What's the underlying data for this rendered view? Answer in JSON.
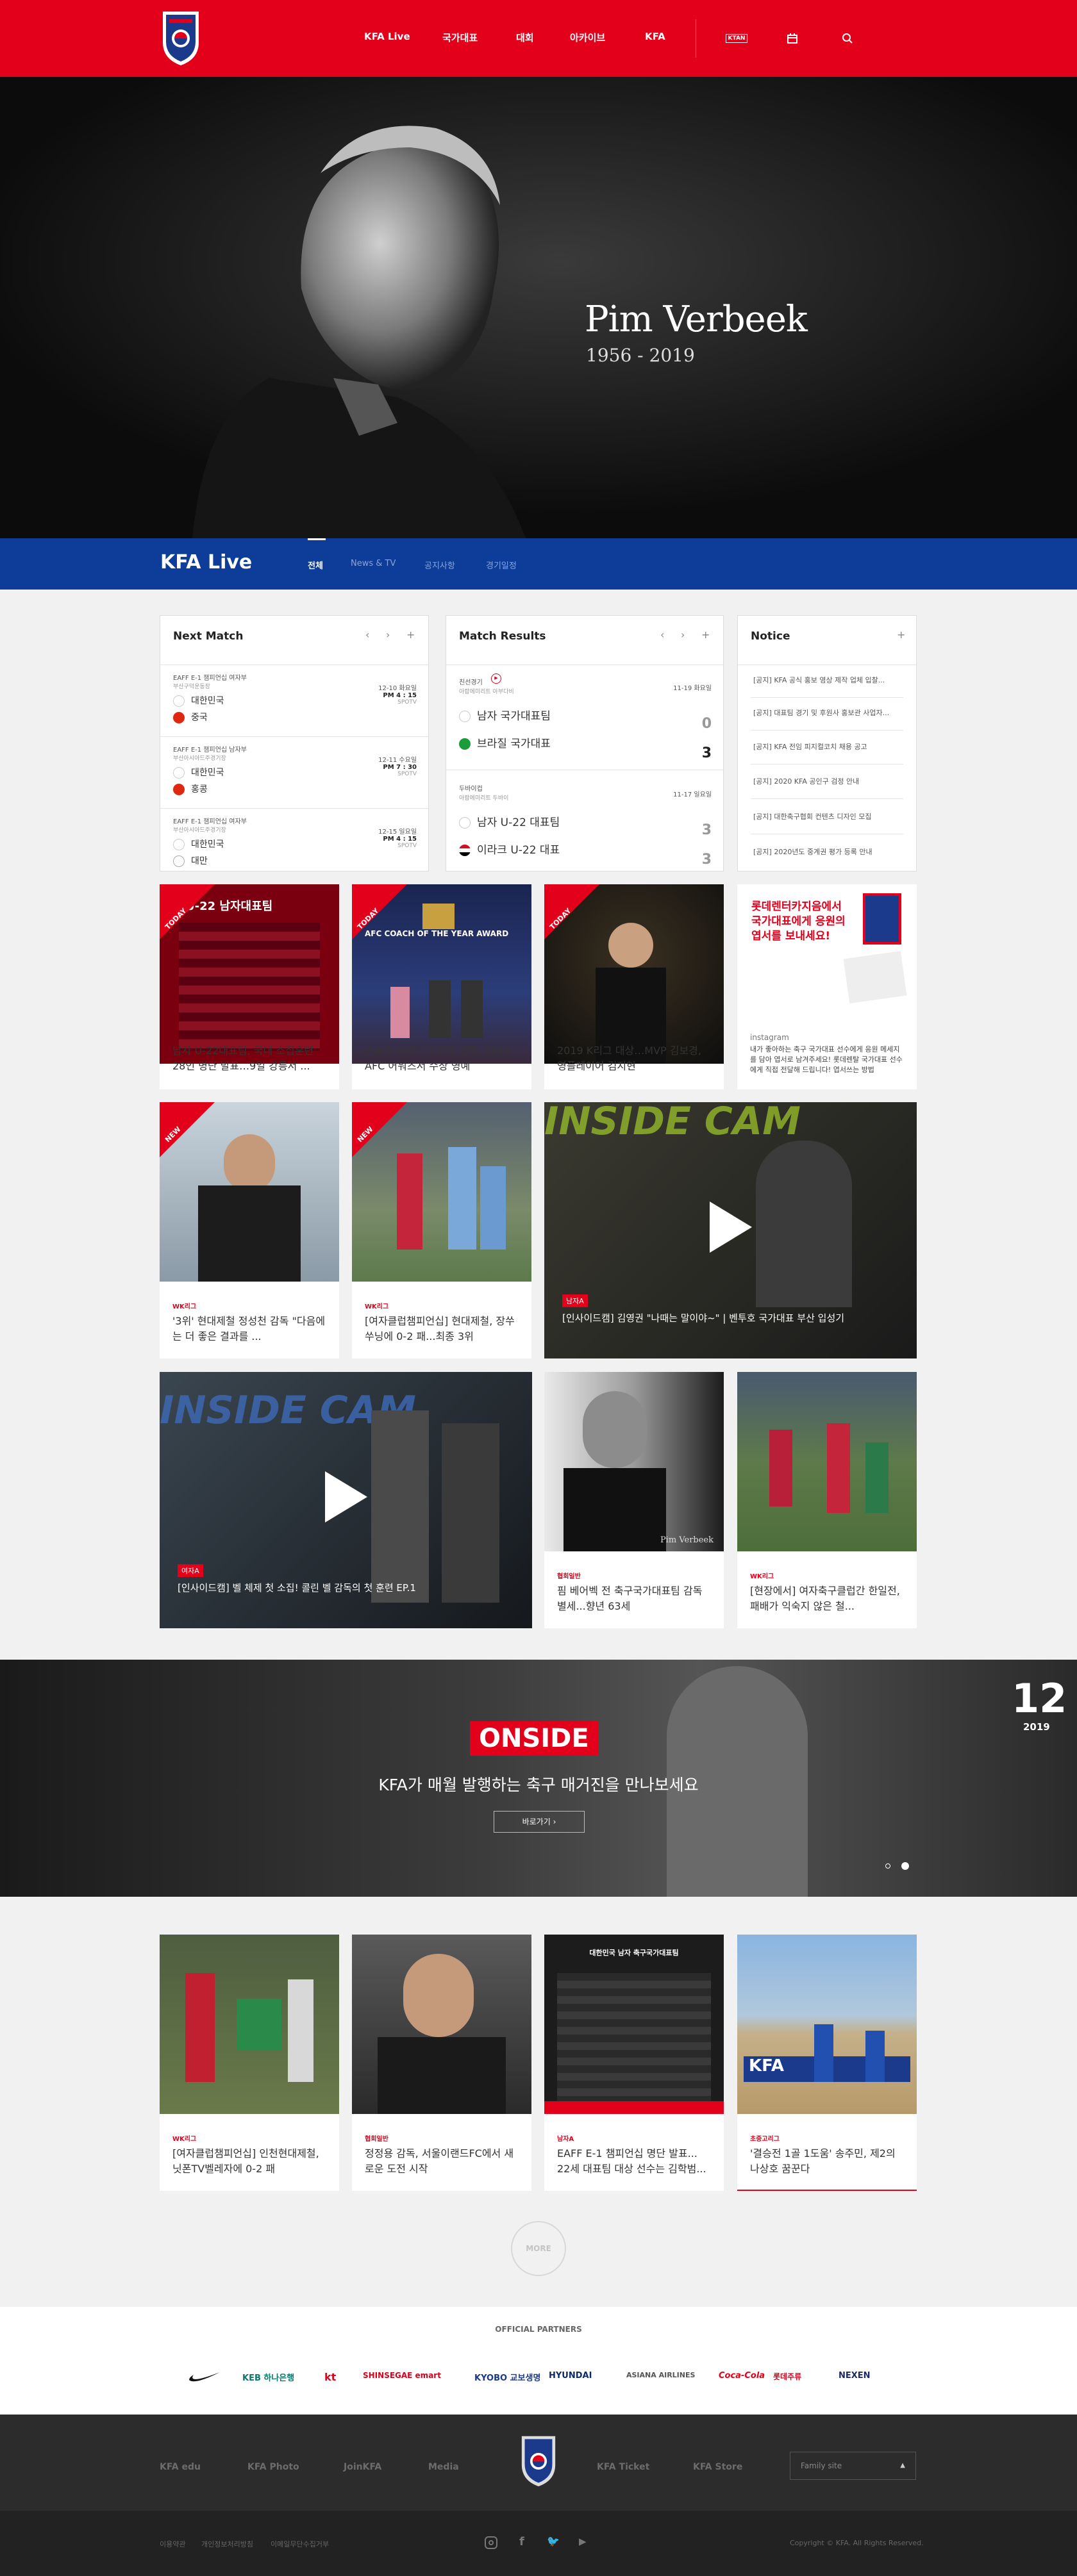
{
  "header": {
    "nav": [
      "KFA Live",
      "국가대표",
      "대회",
      "아카이브",
      "KFA"
    ],
    "ktan_label": "KTAN"
  },
  "hero": {
    "name": "Pim Verbeek",
    "years": "1956 - 2019"
  },
  "live_bar": {
    "title": "KFA Live",
    "tabs": [
      "전체",
      "News & TV",
      "공지사항",
      "경기일정"
    ]
  },
  "next_match": {
    "title": "Next Match",
    "items": [
      {
        "comp": "EAFF E-1 챔피언십 여자부",
        "venue": "부산구덕운동장",
        "home": "대한민국",
        "away": "중국",
        "date": "12-10 화요일",
        "time": "PM 4 : 15",
        "tv": "SPOTV"
      },
      {
        "comp": "EAFF E-1 챔피언십 남자부",
        "venue": "부산아시아드주경기장",
        "home": "대한민국",
        "away": "홍콩",
        "date": "12-11 수요일",
        "time": "PM 7 : 30",
        "tv": "SPOTV"
      },
      {
        "comp": "EAFF E-1 챔피언십 여자부",
        "venue": "부산아시아드주경기장",
        "home": "대한민국",
        "away": "대만",
        "date": "12-15 일요일",
        "time": "PM 4 : 15",
        "tv": "SPOTV"
      }
    ]
  },
  "match_results": {
    "title": "Match Results",
    "items": [
      {
        "type": "친선경기",
        "venue": "아랍에미리트 아부다비",
        "date": "11-19 화요일",
        "home": "남자 국가대표팀",
        "home_score": "0",
        "away": "브라질 국가대표",
        "away_score": "3"
      },
      {
        "type": "두바이컵",
        "venue": "아랍에미리트 두바이",
        "date": "11-17 일요일",
        "home": "남자 U-22 대표팀",
        "home_score": "3",
        "away": "이라크 U-22 대표",
        "away_score": "3"
      }
    ]
  },
  "notice": {
    "title": "Notice",
    "items": [
      "[공지] KFA 공식 홍보 영상 제작 업체 입찰...",
      "[공지] 대표팀 경기 및 후원사 홍보관 사업자...",
      "[공지] KFA 전임 피지컬코치 채용 공고",
      "[공지] 2020 KFA 공인구 검정 안내",
      "[공지] 대한축구협회 컨텐츠 디자인 모집",
      "[공지] 2020년도 중계권 평가 등록 안내"
    ]
  },
  "cards_row1": [
    {
      "ribbon": "TODAY",
      "cat": "",
      "title": "남자 U-22대표팀, 국내 소집훈련 28인 명단 발표…9일 강릉서 ...",
      "img_text": "U-22 남자대표팀"
    },
    {
      "ribbon": "TODAY",
      "cat": "",
      "title": "손흥민·이강인·정정용 감독, 2019 AFC 어워즈서 수상 영예",
      "img_text": "AFC COACH OF THE YEAR AWARD"
    },
    {
      "ribbon": "TODAY",
      "cat": "",
      "title": "2019 K리그 대상…MVP 김보경, 영플레이어 김지현",
      "img_text": ""
    },
    {
      "ribbon": "",
      "cat": "",
      "title": "내가 좋아하는 축구 국가대표 선수에게 응원 메세지를 담아 엽서로 남겨주세요! 롯데렌탈 국가대표 선수에게 직접 전달해 드립니다! 엽서쓰는 방법",
      "img_text": "롯데렌터카지음에서 국가대표에게 응원의 엽서를 보내세요!",
      "extra": "instagram"
    }
  ],
  "cards_row2": [
    {
      "ribbon": "NEW",
      "cat": "WK리그",
      "title": "'3위' 현대제철 정성천 감독 \"다음에는 더 좋은 결과를 ..."
    },
    {
      "ribbon": "NEW",
      "cat": "WK리그",
      "title": "[여자클럽챔피언십] 현대제철, 장쑤쑤닝에 0-2 패...최종 3위"
    },
    {
      "video": true,
      "tag": "남자A",
      "caption": "[인사이드캠] 김영권 \"나때는 말이야~\" | 벤투호 국가대표 부산 입성기",
      "img_text": "INSIDE CAM"
    }
  ],
  "cards_row3": [
    {
      "video": true,
      "tag": "여자A",
      "caption": "[인사이드캠] 벨 체제 첫 소집! 콜린 벨 감독의 첫 훈련 EP.1",
      "img_text": "INSIDE CAM"
    },
    {
      "cat": "협회일반",
      "title": "핌 베어벡 전 축구국가대표팀 감독 별세...향년 63세",
      "img_text": "Pim Verbeek"
    },
    {
      "cat": "WK리그",
      "title": "[현장에서] 여자축구클럽간 한일전, 패배가 익숙지 않은 철..."
    }
  ],
  "onside": {
    "logo": "ONSIDE",
    "subtitle": "KFA가 매월 발행하는 축구 매거진을 만나보세요",
    "button": "바로가기",
    "month": "12",
    "year": "2019"
  },
  "cards_row4": [
    {
      "cat": "WK리그",
      "title": "[여자클럽챔피언십] 인천현대제철, 닛폰TV벨레자에 0-2 패"
    },
    {
      "cat": "협회일반",
      "title": "정정용 감독, 서울이랜드FC에서 새로운 도전 시작"
    },
    {
      "cat": "남자A",
      "title": "EAFF E-1 챔피언십 명단 발표... 22세 대표팀 대상 선수는 김학범...",
      "img_text": "대한민국 남자 축구국가대표팀"
    },
    {
      "cat": "초중고리그",
      "title": "'결승전 1골 1도움' 송주민, 제2의 나상호 꿈꾼다",
      "img_text": "KFA"
    }
  ],
  "more_label": "MORE",
  "partners": {
    "title": "OFFICIAL PARTNERS",
    "logos": [
      "KEB 하나은행",
      "kt",
      "SHINSEGAE emart",
      "KYOBO 교보생명",
      "HYUNDAI",
      "ASIANA AIRLINES",
      "Coca-Cola",
      "롯데주류",
      "NEXEN"
    ]
  },
  "footer": {
    "links": [
      "KFA edu",
      "KFA Photo",
      "JoinKFA",
      "Media",
      "KFA Ticket",
      "KFA Store"
    ],
    "family_site": "Family site",
    "bottom_links": [
      "이용약관",
      "개인정보처리방침",
      "이메일무단수집거부"
    ],
    "copyright": "Copyright © KFA. All Rights Reserved."
  },
  "colors": {
    "brand_red": "#e3001b",
    "live_blue": "#0d3d99"
  }
}
